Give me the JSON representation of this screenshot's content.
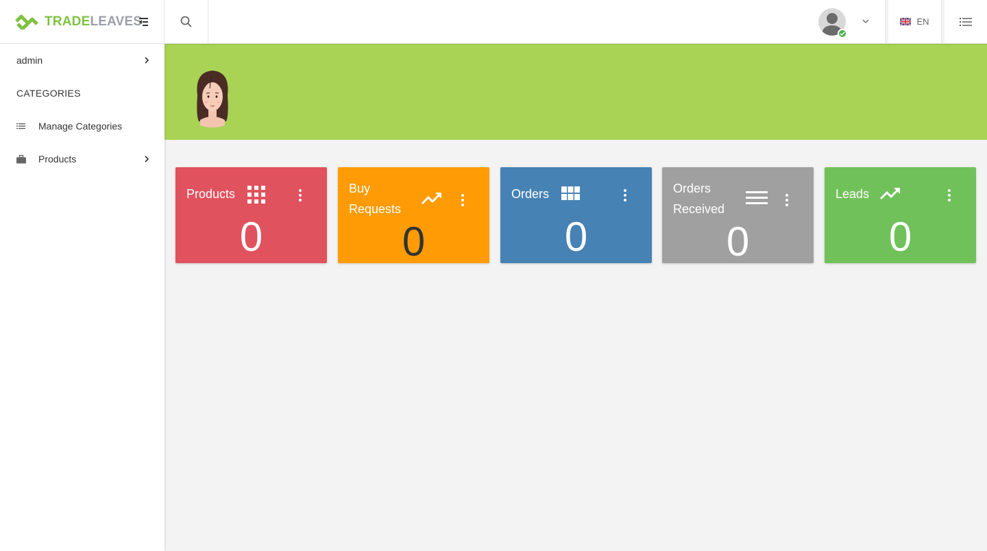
{
  "brand": {
    "name_part1": "TRADE",
    "name_part2": "LEAVES"
  },
  "header": {
    "language_label": "EN"
  },
  "sidebar": {
    "user_label": "admin",
    "section_title": "CATEGORIES",
    "items": [
      {
        "label": "Manage Categories",
        "icon": "list-icon"
      },
      {
        "label": "Products",
        "icon": "briefcase-icon"
      }
    ]
  },
  "cards": [
    {
      "title": "Products",
      "value": "0",
      "color": "#e0525e",
      "icon": "apps-grid-icon"
    },
    {
      "title": "Buy Requests",
      "value": "0",
      "color": "#ff9b05",
      "icon": "trending-up-icon"
    },
    {
      "title": "Orders",
      "value": "0",
      "color": "#4682b4",
      "icon": "grid-icon"
    },
    {
      "title": "Orders Received",
      "value": "0",
      "color": "#a0a0a0",
      "icon": "menu-lines-icon"
    },
    {
      "title": "Leads",
      "value": "0",
      "color": "#71c15a",
      "icon": "trending-up-icon"
    }
  ],
  "colors": {
    "brand_green": "#7dc242",
    "banner": "#a9d355",
    "background": "#f3f3f3",
    "status_online": "#4caf50"
  }
}
